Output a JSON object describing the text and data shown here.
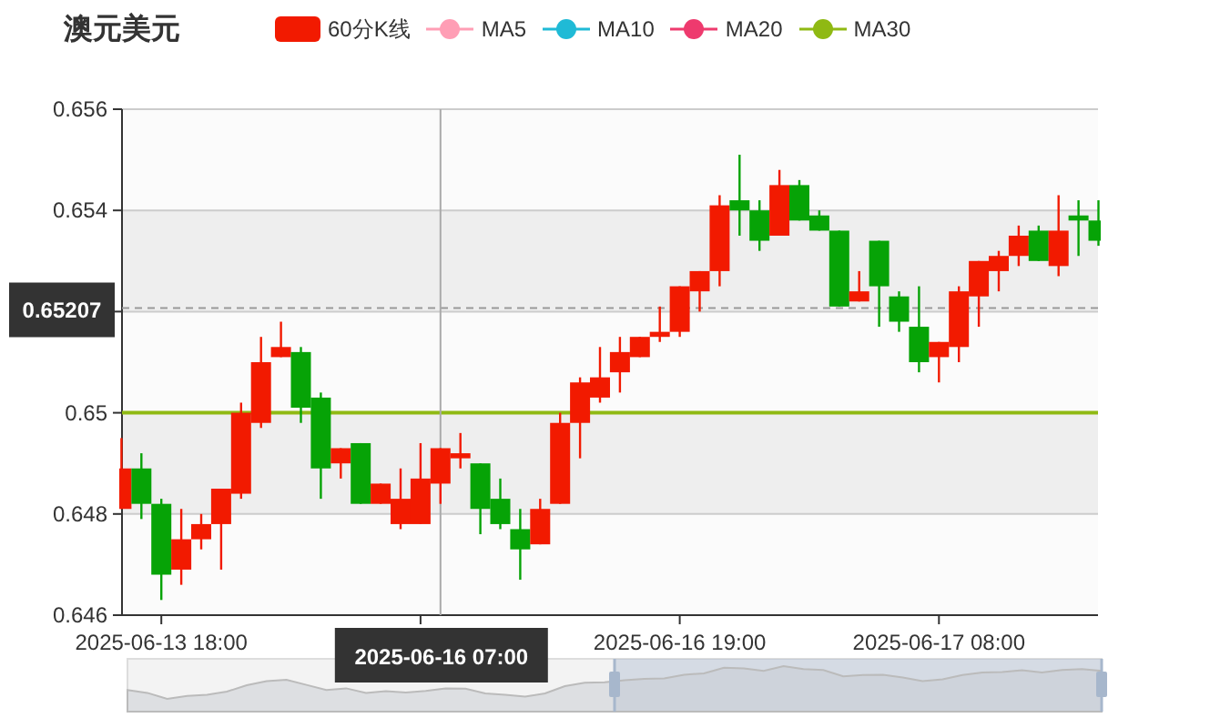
{
  "title": "澳元美元",
  "legend": [
    {
      "label": "60分K线",
      "kind": "candle",
      "color": "#f21a00"
    },
    {
      "label": "MA5",
      "kind": "line",
      "color": "#ff9eb5"
    },
    {
      "label": "MA10",
      "kind": "line",
      "color": "#1fbad6"
    },
    {
      "label": "MA20",
      "kind": "line",
      "color": "#ee3a6e"
    },
    {
      "label": "MA30",
      "kind": "line",
      "color": "#8fb913"
    }
  ],
  "chart_data": {
    "type": "candlestick",
    "ylim": [
      0.646,
      0.656
    ],
    "yticks": [
      0.646,
      0.648,
      0.65,
      0.654,
      0.656
    ],
    "categories": [
      null,
      null,
      "2025-06-13 18:00",
      null,
      null,
      null,
      null,
      null,
      null,
      null,
      null,
      null,
      null,
      null,
      null,
      null,
      null,
      null,
      null,
      null,
      null,
      null,
      null,
      null,
      null,
      null,
      null,
      null,
      "2025-06-16 19:00",
      null,
      null,
      null,
      null,
      null,
      null,
      null,
      null,
      null,
      null,
      null,
      null,
      "2025-06-17 08:00",
      null,
      null,
      null,
      null,
      null,
      null,
      null,
      null
    ],
    "series": [
      {
        "ohlc": [
          [
            0.6481,
            0.6495,
            0.6481,
            0.6489
          ],
          [
            0.6489,
            0.6492,
            0.6479,
            0.6482
          ],
          [
            0.6482,
            0.6483,
            0.6463,
            0.6468
          ],
          [
            0.6469,
            0.6481,
            0.6466,
            0.6475
          ],
          [
            0.6475,
            0.648,
            0.6473,
            0.6478
          ],
          [
            0.6478,
            0.6485,
            0.6469,
            0.6485
          ],
          [
            0.6484,
            0.6502,
            0.6483,
            0.65
          ],
          [
            0.6498,
            0.6515,
            0.6497,
            0.651
          ],
          [
            0.6511,
            0.6518,
            0.6511,
            0.6513
          ],
          [
            0.6512,
            0.6513,
            0.6498,
            0.6501
          ],
          [
            0.6503,
            0.6504,
            0.6483,
            0.6489
          ],
          [
            0.649,
            0.6493,
            0.6487,
            0.6493
          ],
          [
            0.6494,
            0.6494,
            0.6482,
            0.6482
          ],
          [
            0.6482,
            0.6486,
            0.6482,
            0.6486
          ],
          [
            0.6478,
            0.6489,
            0.6477,
            0.6483
          ],
          [
            0.6478,
            0.6494,
            0.6478,
            0.6487
          ],
          [
            0.6486,
            0.6493,
            0.6482,
            0.6493
          ],
          [
            0.6491,
            0.6496,
            0.6489,
            0.6492
          ],
          [
            0.649,
            0.649,
            0.6476,
            0.6481
          ],
          [
            0.6483,
            0.6487,
            0.6477,
            0.6478
          ],
          [
            0.6477,
            0.6481,
            0.6467,
            0.6473
          ],
          [
            0.6474,
            0.6483,
            0.6474,
            0.6481
          ],
          [
            0.6482,
            0.65,
            0.6482,
            0.6498
          ],
          [
            0.6498,
            0.6507,
            0.6491,
            0.6506
          ],
          [
            0.6503,
            0.6513,
            0.6502,
            0.6507
          ],
          [
            0.6508,
            0.6515,
            0.6504,
            0.6512
          ],
          [
            0.6511,
            0.6515,
            0.6511,
            0.6515
          ],
          [
            0.6515,
            0.6521,
            0.6514,
            0.6516
          ],
          [
            0.6516,
            0.6525,
            0.6515,
            0.6525
          ],
          [
            0.6524,
            0.6528,
            0.652,
            0.6528
          ],
          [
            0.6528,
            0.6543,
            0.6525,
            0.6541
          ],
          [
            0.6542,
            0.6551,
            0.6535,
            0.654
          ],
          [
            0.654,
            0.6542,
            0.6532,
            0.6534
          ],
          [
            0.6535,
            0.6548,
            0.6535,
            0.6545
          ],
          [
            0.6545,
            0.6546,
            0.6538,
            0.6538
          ],
          [
            0.6539,
            0.654,
            0.6536,
            0.6536
          ],
          [
            0.6536,
            0.6536,
            0.6521,
            0.6521
          ],
          [
            0.6522,
            0.6528,
            0.6522,
            0.6524
          ],
          [
            0.6534,
            0.6534,
            0.6517,
            0.6525
          ],
          [
            0.6523,
            0.6524,
            0.6516,
            0.6518
          ],
          [
            0.6517,
            0.6525,
            0.6508,
            0.651
          ],
          [
            0.6511,
            0.6514,
            0.6506,
            0.6514
          ],
          [
            0.6513,
            0.6525,
            0.651,
            0.6524
          ],
          [
            0.6523,
            0.653,
            0.6517,
            0.653
          ],
          [
            0.6528,
            0.6532,
            0.6524,
            0.6531
          ],
          [
            0.6531,
            0.6537,
            0.6529,
            0.6535
          ],
          [
            0.6536,
            0.6537,
            0.653,
            0.653
          ],
          [
            0.6529,
            0.6543,
            0.6527,
            0.6536
          ],
          [
            0.6539,
            0.6542,
            0.6531,
            0.6538
          ],
          [
            0.6538,
            0.6542,
            0.6533,
            0.6534
          ]
        ]
      }
    ],
    "ref_lines": [
      {
        "axis": "y",
        "value": 0.65,
        "color": "#8fb913"
      },
      {
        "axis": "y",
        "value": 0.65207,
        "label": "0.65207"
      }
    ],
    "bands": [
      {
        "axis": "y",
        "from": 0.652,
        "to": 0.654
      },
      {
        "axis": "y",
        "from": 0.648,
        "to": 0.65
      }
    ]
  },
  "time_pointer": {
    "label": "2025-06-16 07:00"
  },
  "zoom_slider": {
    "level": 0.5
  }
}
